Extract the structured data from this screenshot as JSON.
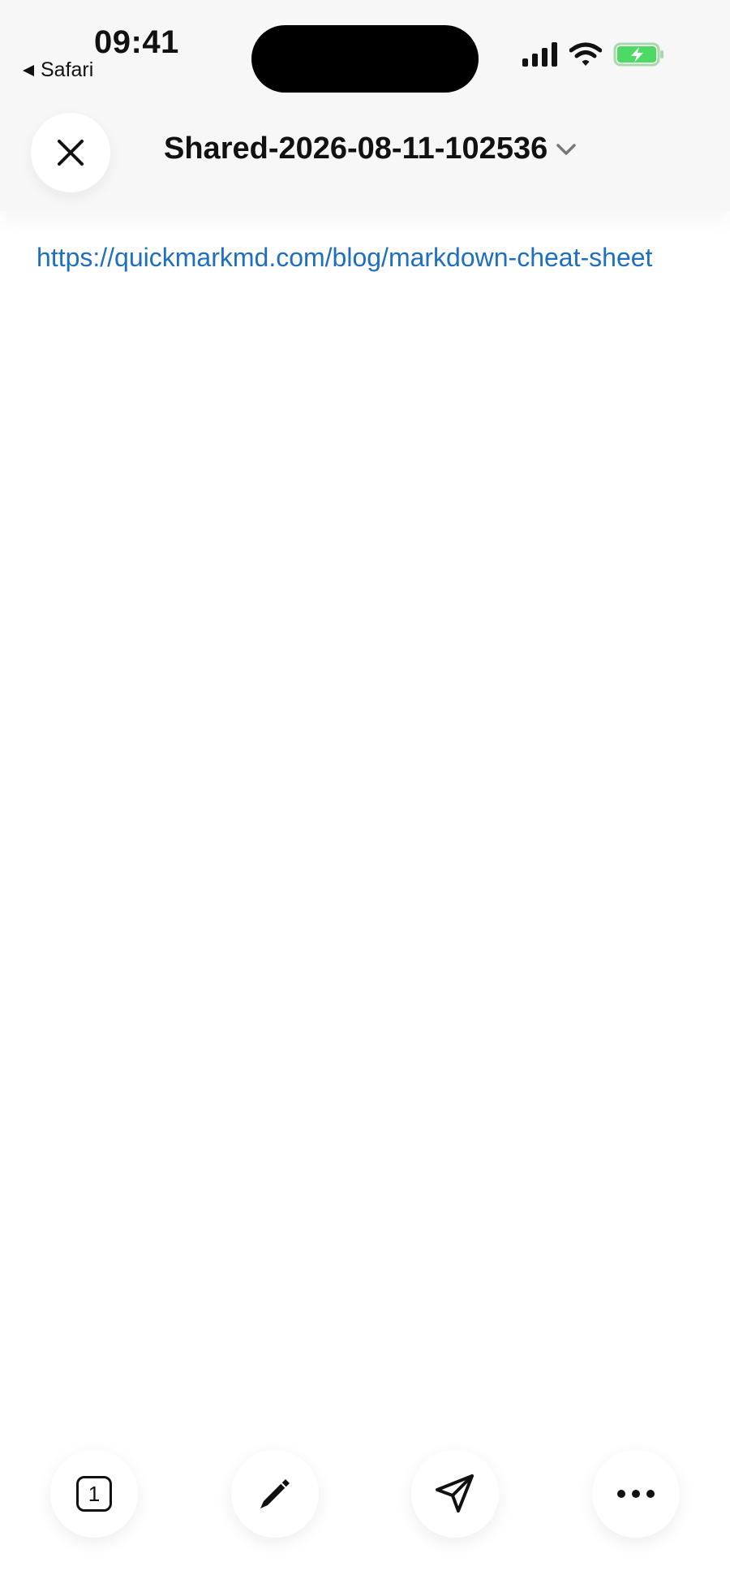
{
  "status_bar": {
    "time": "09:41",
    "back_app": "Safari",
    "battery_color": "#4cd964"
  },
  "header": {
    "close_icon": "close-icon",
    "title": "Shared-2026-08-11-102536",
    "chevron_icon": "chevron-down-icon"
  },
  "content": {
    "link_text": "https://quickmarkmd.com/blog/markdown-cheat-sheet",
    "link_color": "#1f6fc1"
  },
  "toolbar": {
    "tabs_count": "1",
    "items": [
      "tabs-count-icon",
      "pencil-icon",
      "send-icon",
      "more-icon"
    ]
  }
}
